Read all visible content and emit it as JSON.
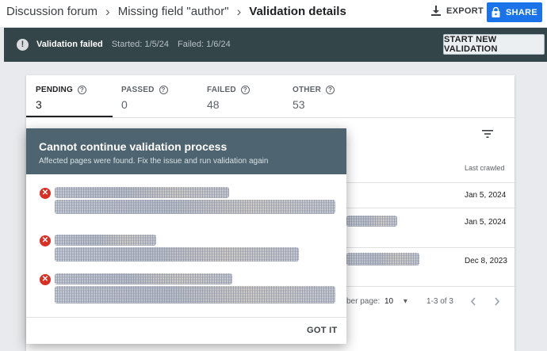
{
  "breadcrumb": {
    "items": [
      "Discussion forum",
      "Missing field \"author\"",
      "Validation details"
    ],
    "separator": "›"
  },
  "actions": {
    "export_label": "EXPORT",
    "share_label": "SHARE"
  },
  "status": {
    "icon": "info-icon",
    "title": "Validation failed",
    "started": "Started: 1/5/24",
    "failed": "Failed: 1/6/24",
    "button_label": "START NEW VALIDATION"
  },
  "tabs": [
    {
      "label": "PENDING",
      "count": "3"
    },
    {
      "label": "PASSED",
      "count": "0"
    },
    {
      "label": "FAILED",
      "count": "48"
    },
    {
      "label": "OTHER",
      "count": "53"
    }
  ],
  "table": {
    "column_last_crawled": "Last crawled",
    "rows": [
      {
        "date": "Jan 5, 2024"
      },
      {
        "date": "Jan 5, 2024"
      },
      {
        "date": "Dec 8, 2023"
      }
    ],
    "pager": {
      "rows_per_page_label": "ber page:",
      "rows_per_page_value": "10",
      "range": "1-3 of 3"
    }
  },
  "modal": {
    "title": "Cannot continue validation process",
    "subtitle": "Affected pages were found. Fix the issue and run validation again",
    "button_label": "GOT IT"
  },
  "colors": {
    "status_bar": "#34454a",
    "modal_header": "#4e6571",
    "share_button": "#1a73e8",
    "error": "#d93025"
  }
}
